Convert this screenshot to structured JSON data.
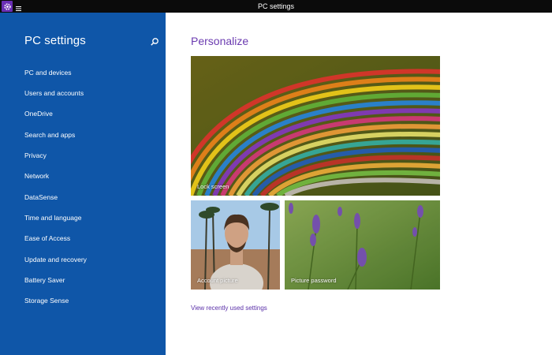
{
  "window": {
    "title": "PC settings",
    "icons": {
      "app": "gear-icon",
      "menu": "hamburger-menu-icon"
    }
  },
  "sidebar": {
    "heading": "PC settings",
    "search_icon": "search-icon",
    "items": [
      {
        "label": "PC and devices"
      },
      {
        "label": "Users and accounts"
      },
      {
        "label": "OneDrive"
      },
      {
        "label": "Search and apps"
      },
      {
        "label": "Privacy"
      },
      {
        "label": "Network"
      },
      {
        "label": "DataSense"
      },
      {
        "label": "Time and language"
      },
      {
        "label": "Ease of Access"
      },
      {
        "label": "Update and recovery"
      },
      {
        "label": "Battery Saver"
      },
      {
        "label": "Storage Sense"
      }
    ]
  },
  "main": {
    "title": "Personalize",
    "tiles": {
      "lock_screen": "Lock screen",
      "account_picture": "Account picture",
      "picture_password": "Picture password"
    },
    "link": "View recently used settings"
  },
  "colors": {
    "sidebar_bg": "#0f56a8",
    "accent_purple": "#6b3bb0",
    "titlebar_bg": "#0b0b0b"
  }
}
